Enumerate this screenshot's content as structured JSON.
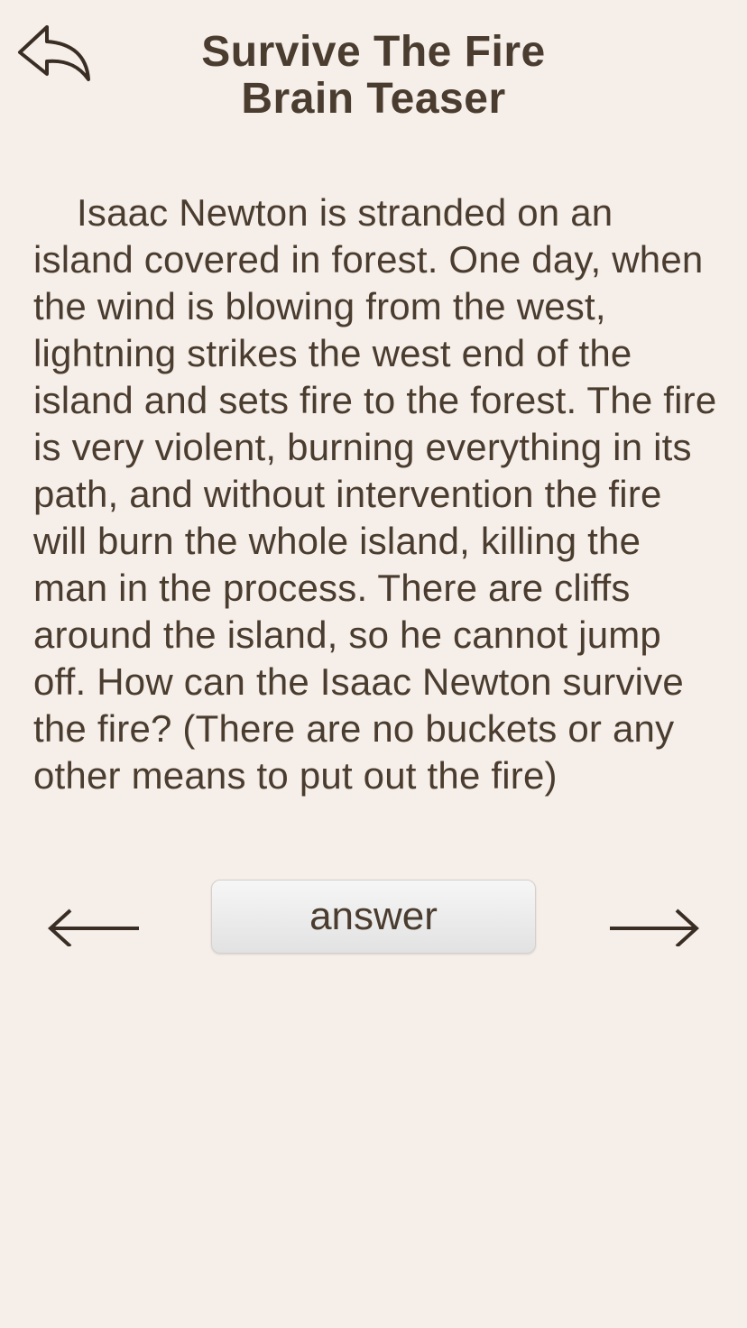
{
  "header": {
    "title_line1": "Survive The Fire",
    "title_line2": "Brain Teaser",
    "back_icon": "reply-arrow-icon"
  },
  "question": {
    "text": "Isaac Newton is stranded on an island covered in forest. One day, when the wind is blowing from the west, lightning strikes the west end of the island and sets fire to the forest. The fire is very violent, burning everything in its path, and without intervention the fire will burn the whole island, killing the man in the process. There are cliffs around the island, so he cannot jump off. How can the Isaac Newton survive the fire? (There are no buckets or any other means to put out the fire)"
  },
  "controls": {
    "answer_label": "answer",
    "prev_icon": "arrow-left-icon",
    "next_icon": "arrow-right-icon"
  },
  "colors": {
    "background": "#f5eee9",
    "text": "#4a3c2e",
    "button_top": "#f6f6f6",
    "button_bottom": "#e2e2e2"
  }
}
